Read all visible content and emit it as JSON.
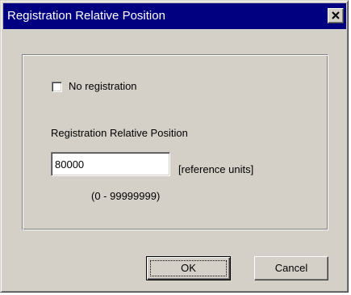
{
  "window": {
    "title": "Registration Relative Position",
    "close_icon": "close-icon"
  },
  "options": {
    "no_registration_label": "No registration",
    "no_registration_checked": false
  },
  "position": {
    "label": "Registration Relative Position",
    "value": "80000",
    "units": "[reference units]",
    "range": "(0 - 99999999)"
  },
  "buttons": {
    "ok_label": "OK",
    "cancel_label": "Cancel"
  },
  "colors": {
    "titlebar": "#000080",
    "face": "#d4d0c8"
  }
}
